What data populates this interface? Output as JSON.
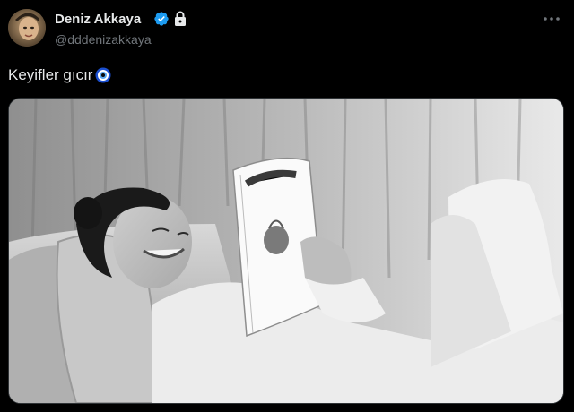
{
  "tweet": {
    "author": {
      "display_name": "Deniz Akkaya",
      "handle": "@dddenizakkaya",
      "verified": true,
      "protected": true
    },
    "text": "Keyifler gıcır",
    "emoji": "nazar-boncugu (evil eye)",
    "media": {
      "type": "photo",
      "description_icon": "photo-image"
    }
  },
  "colors": {
    "background": "#000000",
    "primary_text": "#e7e9ea",
    "secondary_text": "#71767b",
    "verified_blue": "#1d9bf0"
  }
}
